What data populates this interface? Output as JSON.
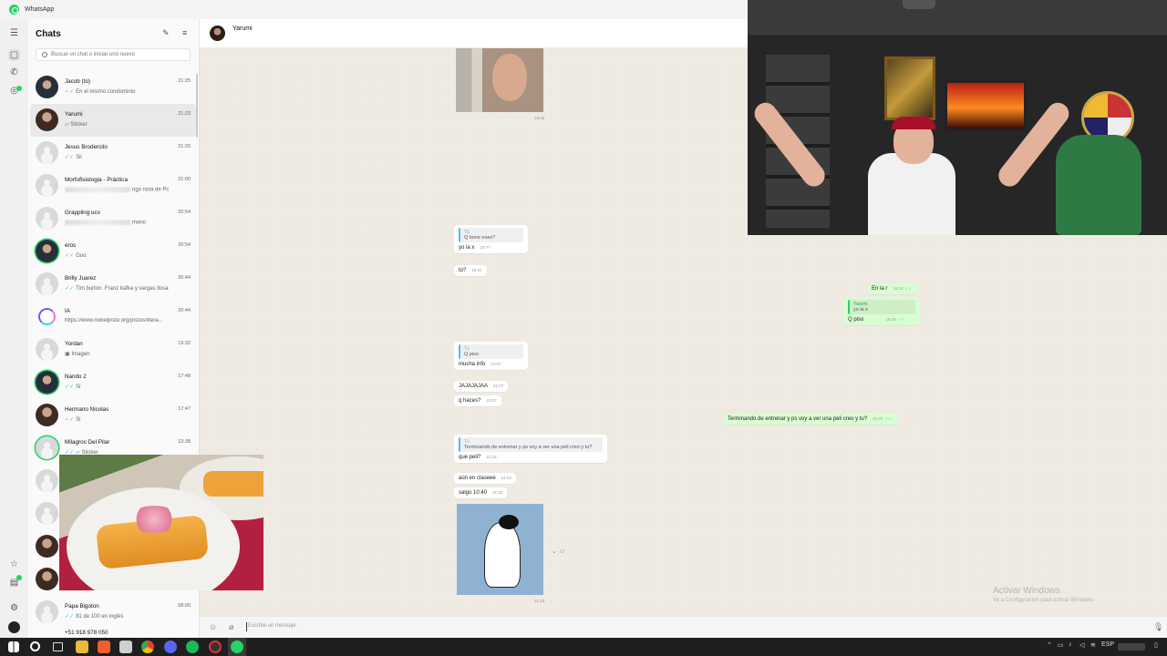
{
  "app": {
    "title": "WhatsApp"
  },
  "chatlist": {
    "title": "Chats",
    "search_placeholder": "Buscar un chat o iniciar uno nuevo",
    "items": [
      {
        "name": "Jacob (tú)",
        "time": "21:25",
        "msg": "En el mismo condominio"
      },
      {
        "name": "Yarumi",
        "time": "21:23",
        "msg": "Sticker"
      },
      {
        "name": "Jesus Brodercito",
        "time": "21:20",
        "msg": "Sii"
      },
      {
        "name": "Morfofisiologia - Práctica",
        "time": "21:00",
        "msg": "ngo nota de Pc"
      },
      {
        "name": "Grappling ucv",
        "time": "20:54",
        "msg": "mano"
      },
      {
        "name": "eros",
        "time": "20:54",
        "msg": "Goo"
      },
      {
        "name": "Brilly Juarez",
        "time": "20:44",
        "msg": "Tim burton .Franz kafka y vargas llosa"
      },
      {
        "name": "IA",
        "time": "20:44",
        "msg": "https://www.nobelprize.org/prizes/litera..."
      },
      {
        "name": "Yordan",
        "time": "19:32",
        "msg": "Imagen"
      },
      {
        "name": "Nando 2",
        "time": "17:48",
        "msg": "Si"
      },
      {
        "name": "Hermano Nicolas",
        "time": "17:47",
        "msg": "Si"
      },
      {
        "name": "Milagros Del Pilar",
        "time": "13:38",
        "msg": "Sticker"
      },
      {
        "name": "Papa Bigoton",
        "time": "08:05",
        "msg": "81 de 100 en inglés"
      },
      {
        "name": "+51 918 978 050",
        "time": "",
        "msg": ""
      }
    ]
  },
  "conversation": {
    "contact": "Yarumi",
    "composer_placeholder": "Escribe un mensaje",
    "messages": {
      "photo_time": "15:45",
      "q1_name": "Tú",
      "q1_text": "Q tome eses?",
      "m1": "yo la x",
      "m1_time": "19:??",
      "m2": "tú?",
      "m2_time": "19:22",
      "q2_name": "Tú",
      "q2_text": "Q piso",
      "m3": "mucha info",
      "m3_time": "21:07",
      "m4": "JAJAJAJAA",
      "m4_time": "21:07",
      "m5": "q haces?",
      "m5_time": "21:07",
      "q3_name": "Tú",
      "q3_text": "Terminando de entrenar y ps voy a ver una peli creo y tu?",
      "m6": "que peli?",
      "m6_time": "21:22",
      "m7": "aún en claseee",
      "m7_time": "21:22",
      "m8": "salgo 10:40",
      "m8_time": "21:22",
      "sticker_time": "21:23",
      "o1": "En la r",
      "o1_time": "19:12",
      "o2_qname": "Yarumi",
      "o2_qtext": "yo la x",
      "o2": "Q piso",
      "o2_time": "19:15",
      "o3": "Terminando de entrenar y ps voy a ver una peli creo y tu?",
      "o3_time": "21:07"
    }
  },
  "watermark": {
    "line1": "Activar Windows",
    "line2": "Ve a Configuración para activar Windows."
  },
  "taskbar": {
    "lang": "ESP"
  },
  "colors": {
    "accent": "#25d366",
    "outgoing": "#d9fdd3",
    "tick": "#53bdeb"
  }
}
